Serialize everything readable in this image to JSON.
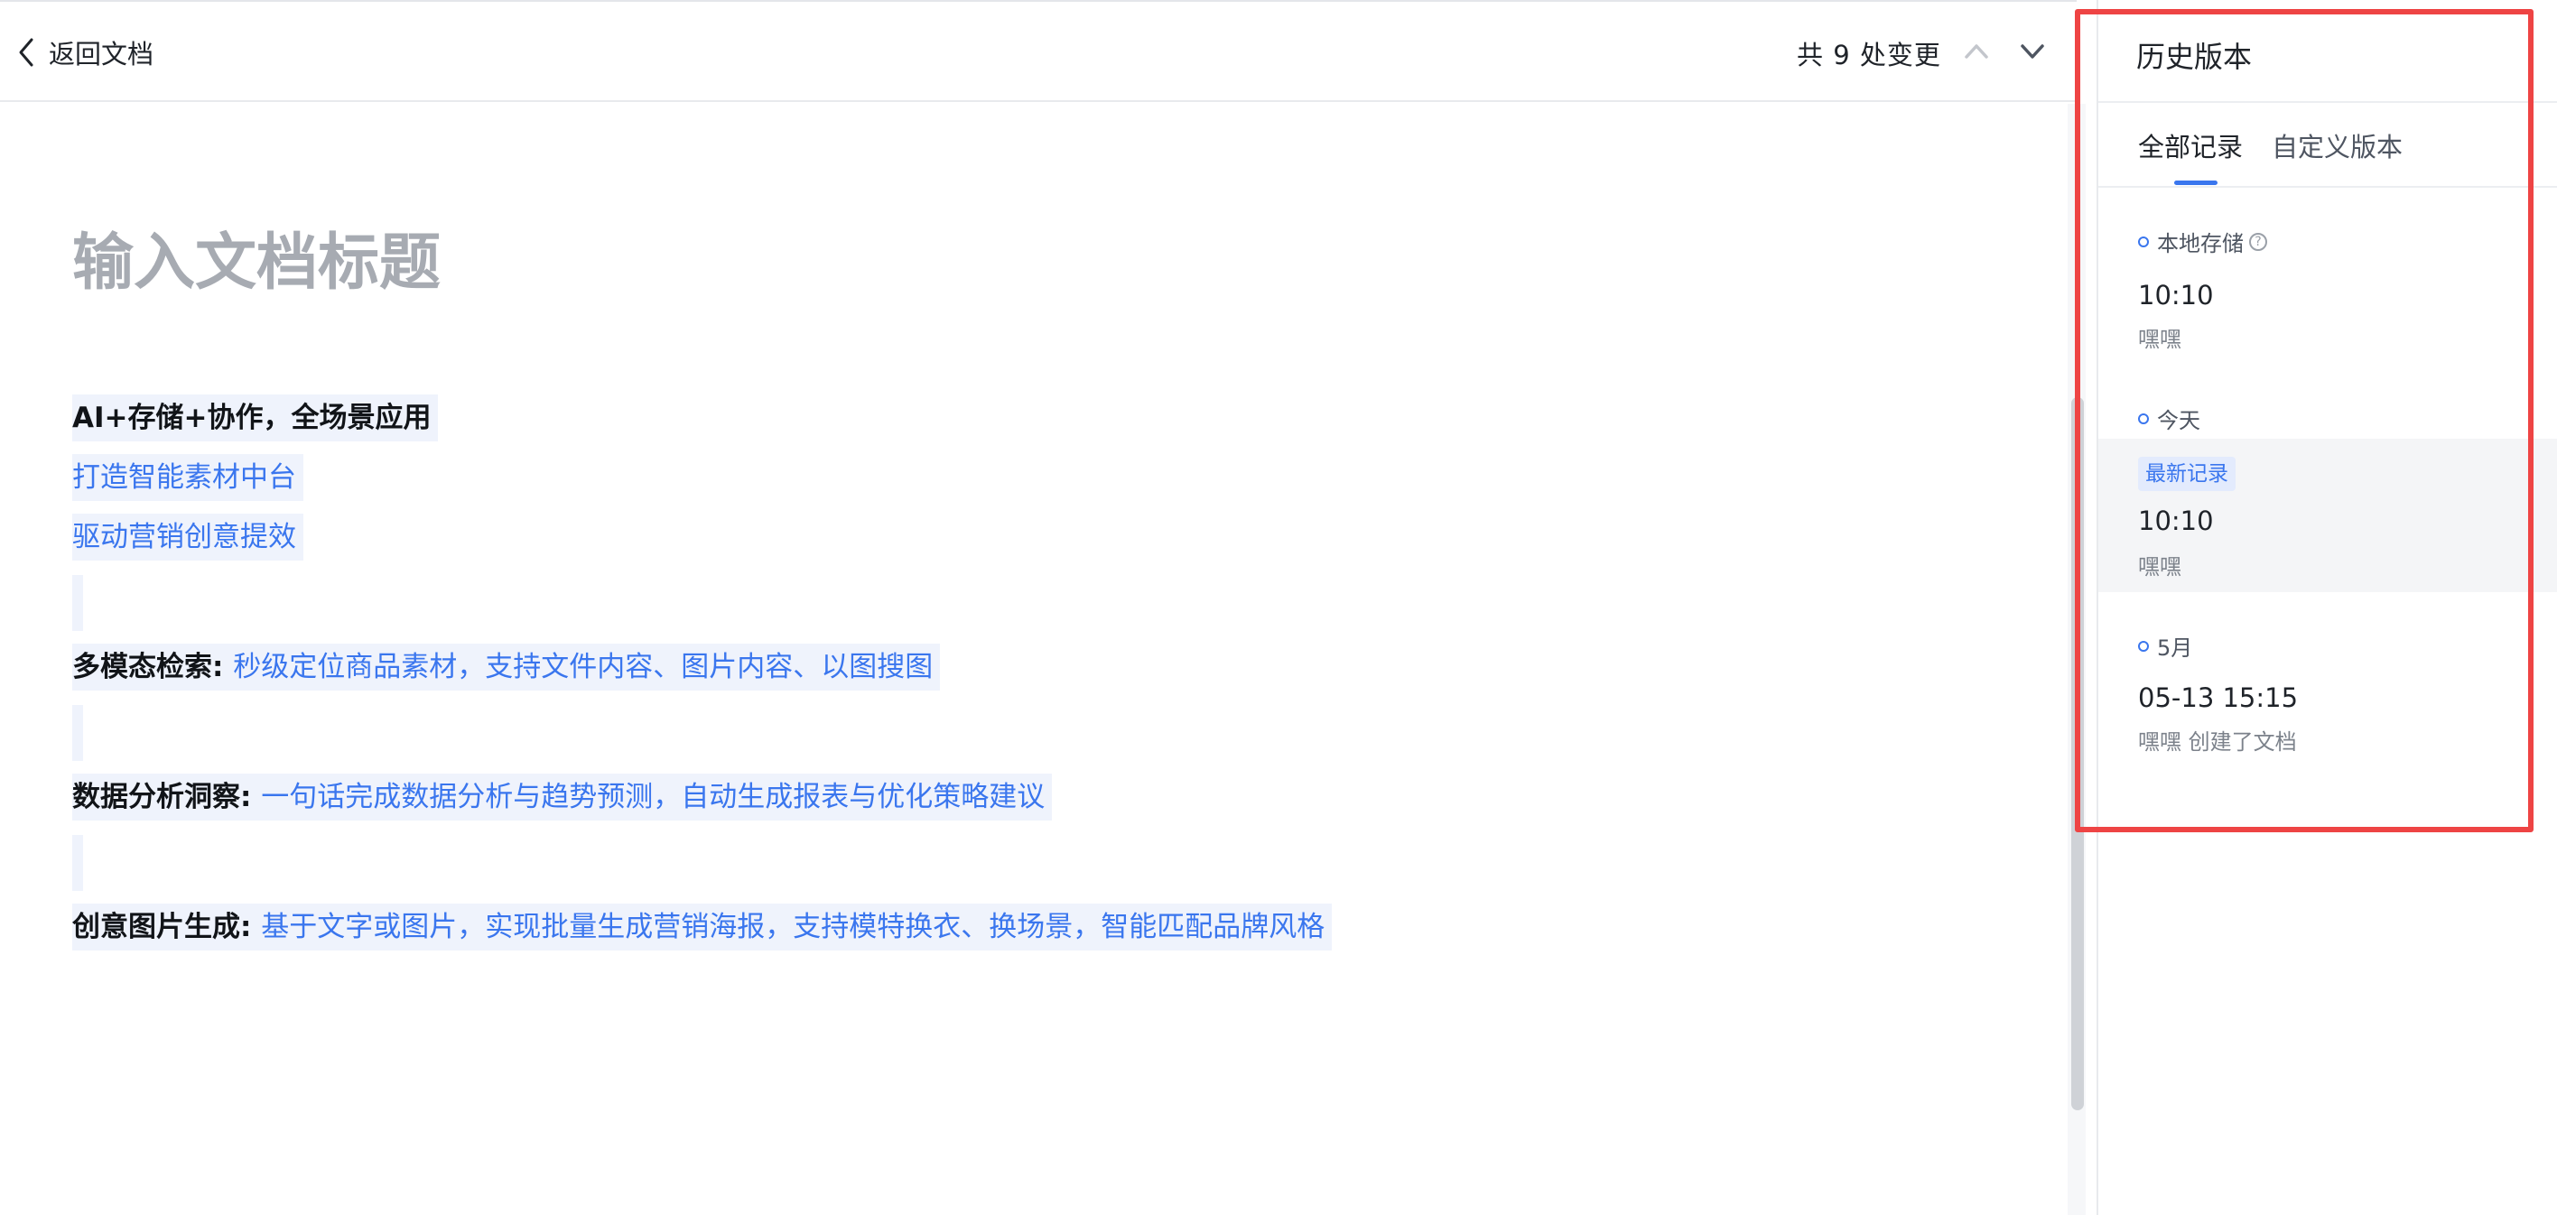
{
  "topbar": {
    "back_label": "返回文档",
    "change_count": "共 9 处变更"
  },
  "document": {
    "title_placeholder": "输入文档标题",
    "lines": [
      {
        "strong": "AI+存储+协作，全场景应用",
        "blue": ""
      },
      {
        "strong": "",
        "blue": "打造智能素材中台"
      },
      {
        "strong": "",
        "blue": "驱动营销创意提效"
      },
      {
        "strong": "多模态检索: ",
        "blue": "秒级定位商品素材，支持文件内容、图片内容、以图搜图"
      },
      {
        "strong": "数据分析洞察: ",
        "blue": "一句话完成数据分析与趋势预测，自动生成报表与优化策略建议"
      },
      {
        "strong": "创意图片生成: ",
        "blue": "基于文字或图片，实现批量生成营销海报，支持模特换衣、换场景，智能匹配品牌风格"
      }
    ]
  },
  "history": {
    "title": "历史版本",
    "tabs": [
      "全部记录",
      "自定义版本"
    ],
    "active_tab": 0,
    "groups": [
      {
        "label": "本地存储",
        "has_help_icon": true,
        "items": [
          {
            "badge": "",
            "time": "10:10",
            "author": "嘿嘿"
          }
        ]
      },
      {
        "label": "今天",
        "has_help_icon": false,
        "items": [
          {
            "badge": "最新记录",
            "time": "10:10",
            "author": "嘿嘿"
          }
        ]
      },
      {
        "label": "5月",
        "has_help_icon": false,
        "items": [
          {
            "badge": "",
            "time": "05-13 15:15",
            "author": "嘿嘿 创建了文档"
          }
        ]
      }
    ]
  },
  "colors": {
    "accent": "#3a76ee",
    "highlight_box": "#ee4444",
    "line_background": "#eff3fc"
  }
}
